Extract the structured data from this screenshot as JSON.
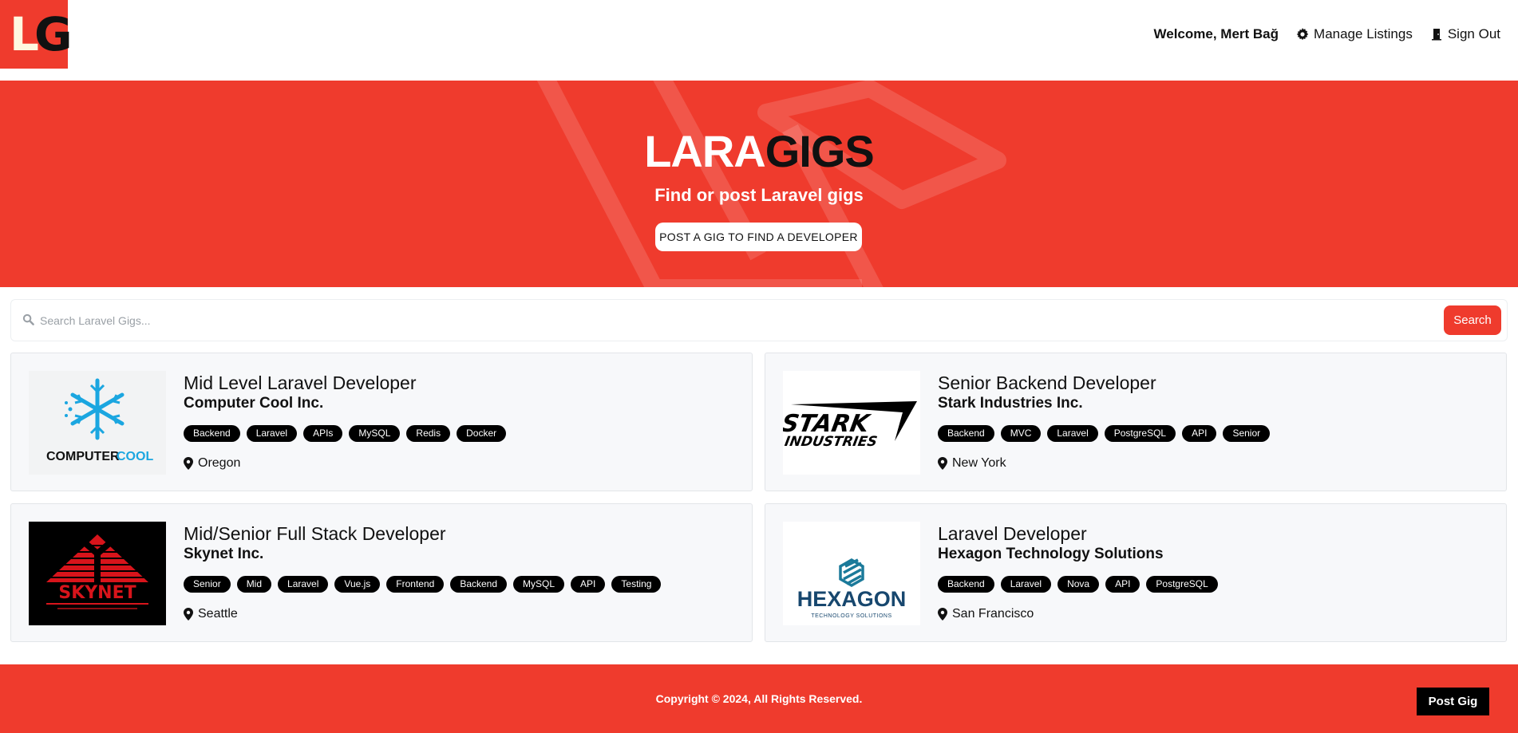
{
  "nav": {
    "logo_left": "L",
    "logo_right": "G",
    "welcome": "Welcome, Mert Bağ",
    "manage_label": "Manage Listings",
    "signout_label": "Sign Out"
  },
  "hero": {
    "title_part1": "LARA",
    "title_part2": "GIGS",
    "subtitle": "Find or post Laravel gigs",
    "cta_label": "POST A GIG TO FIND A DEVELOPER"
  },
  "search": {
    "placeholder": "Search Laravel Gigs...",
    "button_label": "Search"
  },
  "listings": [
    {
      "title": "Mid Level Laravel Developer",
      "company": "Computer Cool Inc.",
      "tags": [
        "Backend",
        "Laravel",
        "APIs",
        "MySQL",
        "Redis",
        "Docker"
      ],
      "location": "Oregon",
      "logo_text_1": "COMPUTER",
      "logo_text_2": "COOL"
    },
    {
      "title": "Senior Backend Developer",
      "company": "Stark Industries Inc.",
      "tags": [
        "Backend",
        "MVC",
        "Laravel",
        "PostgreSQL",
        "API",
        "Senior"
      ],
      "location": "New York",
      "logo_text_1": "STARK",
      "logo_text_2": "INDUSTRIES"
    },
    {
      "title": "Mid/Senior Full Stack Developer",
      "company": "Skynet Inc.",
      "tags": [
        "Senior",
        "Mid",
        "Laravel",
        "Vue.js",
        "Frontend",
        "Backend",
        "MySQL",
        "API",
        "Testing"
      ],
      "location": "Seattle",
      "logo_text_1": "SKYNET"
    },
    {
      "title": "Laravel Developer",
      "company": "Hexagon Technology Solutions",
      "tags": [
        "Backend",
        "Laravel",
        "Nova",
        "API",
        "PostgreSQL"
      ],
      "location": "San Francisco",
      "logo_text_1": "HEXAGON",
      "logo_text_2": "TECHNOLOGY SOLUTIONS"
    }
  ],
  "footer": {
    "copyright": "Copyright © 2024, All Rights Reserved.",
    "post_label": "Post Gig"
  },
  "colors": {
    "brand_red": "#ef3b2d",
    "cool_blue": "#1ba6e0",
    "hexagon_blue": "#17476e"
  }
}
